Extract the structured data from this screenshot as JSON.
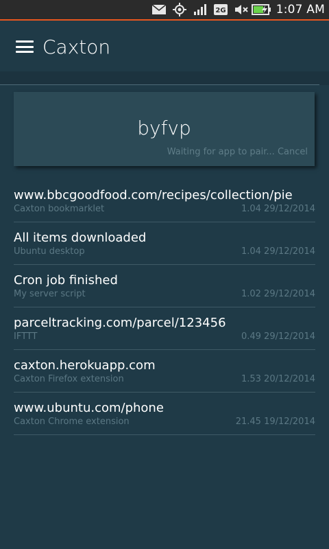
{
  "status_bar": {
    "icons": [
      "mail-icon",
      "location-icon",
      "signal-icon",
      "network-2g-icon",
      "mute-icon",
      "battery-charging-icon"
    ],
    "network_label": "2G",
    "time": "1:07 AM",
    "accent_color": "#e9571f"
  },
  "header": {
    "title": "Caxton",
    "menu_icon": "hamburger-menu-icon"
  },
  "pairing": {
    "code": "byfvp",
    "status": "Waiting for app to pair...",
    "cancel_label": "Cancel"
  },
  "messages": [
    {
      "title": "www.bbcgoodfood.com/recipes/collection/pie",
      "source": "Caxton bookmarklet",
      "time": "1.04 29/12/2014"
    },
    {
      "title": "All items downloaded",
      "source": "Ubuntu desktop",
      "time": "1.04 29/12/2014"
    },
    {
      "title": "Cron job finished",
      "source": "My server script",
      "time": "1.02 29/12/2014"
    },
    {
      "title": "parceltracking.com/parcel/123456",
      "source": "IFTTT",
      "time": "0.49 29/12/2014"
    },
    {
      "title": "caxton.herokuapp.com",
      "source": "Caxton Firefox extension",
      "time": "1.53 20/12/2014"
    },
    {
      "title": "www.ubuntu.com/phone",
      "source": "Caxton Chrome extension",
      "time": "21.45 19/12/2014"
    }
  ]
}
